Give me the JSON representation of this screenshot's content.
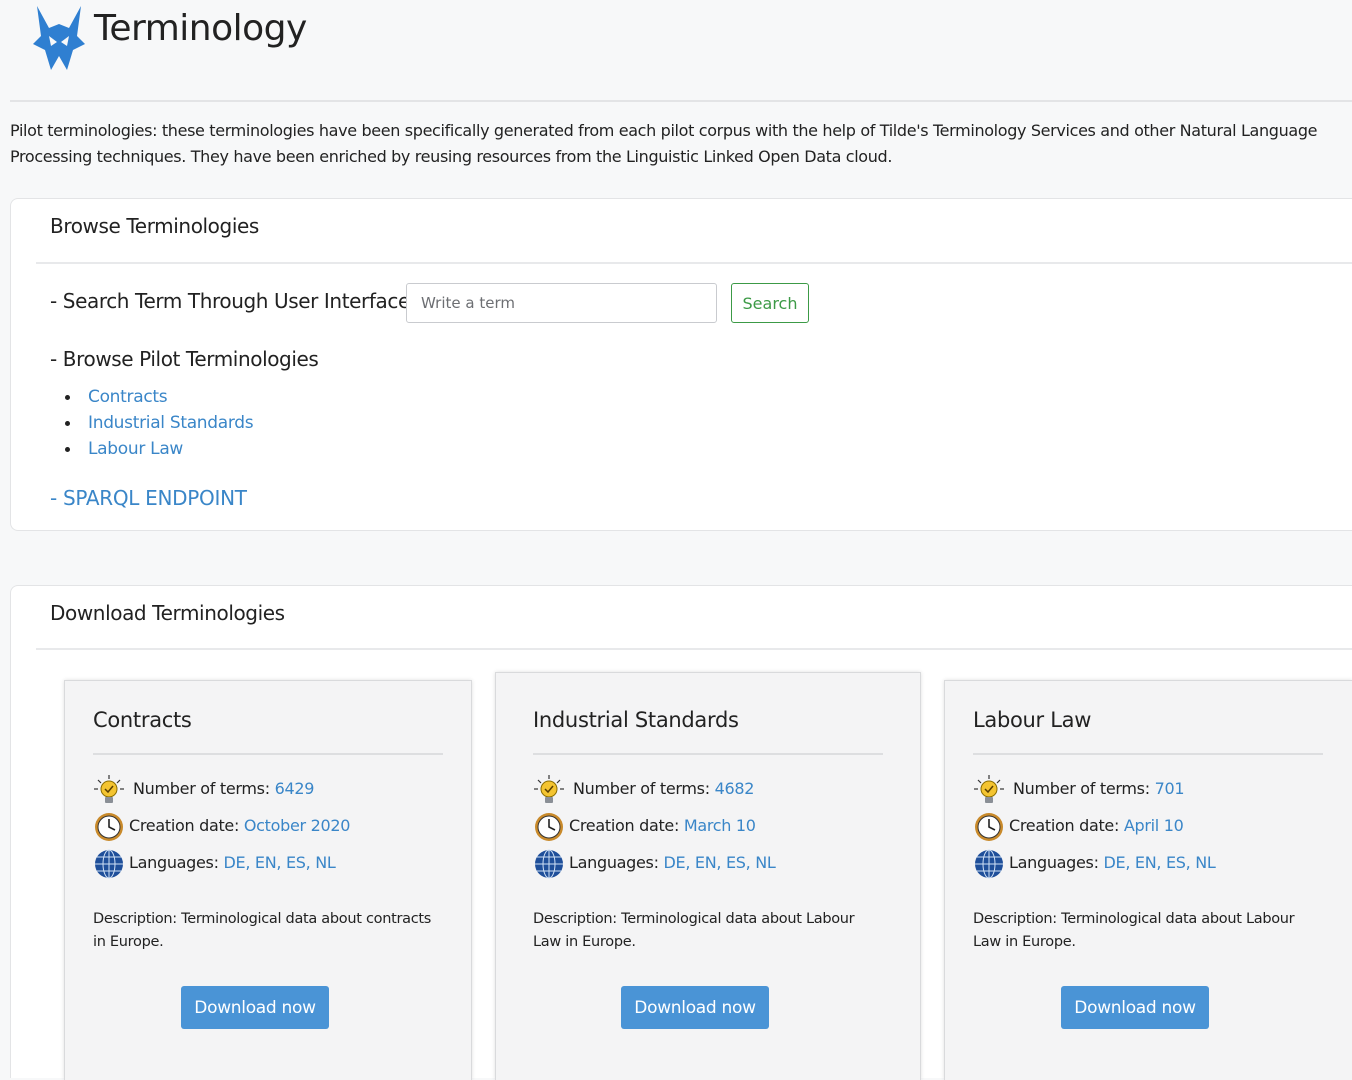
{
  "header": {
    "title": "Terminology",
    "logo_icon": "lynx-logo-icon",
    "brand_color": "#2f7fd1"
  },
  "intro": {
    "text_bold": "Pilot terminologies:",
    "text": " these terminologies have been specifically generated from each pilot corpus with the help of Tilde's Terminology Services and other Natural Language Processing techniques. They have been enriched by reusing resources from the Linguistic Linked Open Data cloud."
  },
  "browse": {
    "title": "Browse Terminologies",
    "search_label": "- Search Term Through User Interface",
    "search_placeholder": "Write a term",
    "search_value": "",
    "search_button": "Search",
    "pilot_label": "- Browse Pilot Terminologies",
    "pilot_items": [
      "Contracts",
      "Industrial Standards",
      "Labour Law"
    ],
    "sparql_label": "- SPARQL ENDPOINT"
  },
  "download": {
    "title": "Download Terminologies",
    "cards": [
      {
        "title": "Contracts",
        "terms_label": "Number of terms:",
        "terms_value": "6429",
        "date_label": "Creation date:",
        "date_value": "October 2020",
        "lang_label": "Languages:",
        "lang_value": "DE, EN, ES, NL",
        "description": "Description: Terminological data about contracts in Europe.",
        "button": "Download now"
      },
      {
        "title": "Industrial Standards",
        "terms_label": "Number of terms:",
        "terms_value": "4682",
        "date_label": "Creation date:",
        "date_value": "March 10",
        "lang_label": "Languages:",
        "lang_value": "DE, EN, ES, NL",
        "description": "Description: Terminological data about Labour Law in Europe.",
        "button": "Download now"
      },
      {
        "title": "Labour Law",
        "terms_label": "Number of terms:",
        "terms_value": "701",
        "date_label": "Creation date:",
        "date_value": "April 10",
        "lang_label": "Languages:",
        "lang_value": "DE, EN, ES, NL",
        "description": "Description: Terminological data about Labour Law in Europe.",
        "button": "Download now"
      }
    ]
  },
  "colors": {
    "link": "#3a86c8",
    "search_button": "#3c9a46",
    "download_button": "#4a94d6"
  }
}
